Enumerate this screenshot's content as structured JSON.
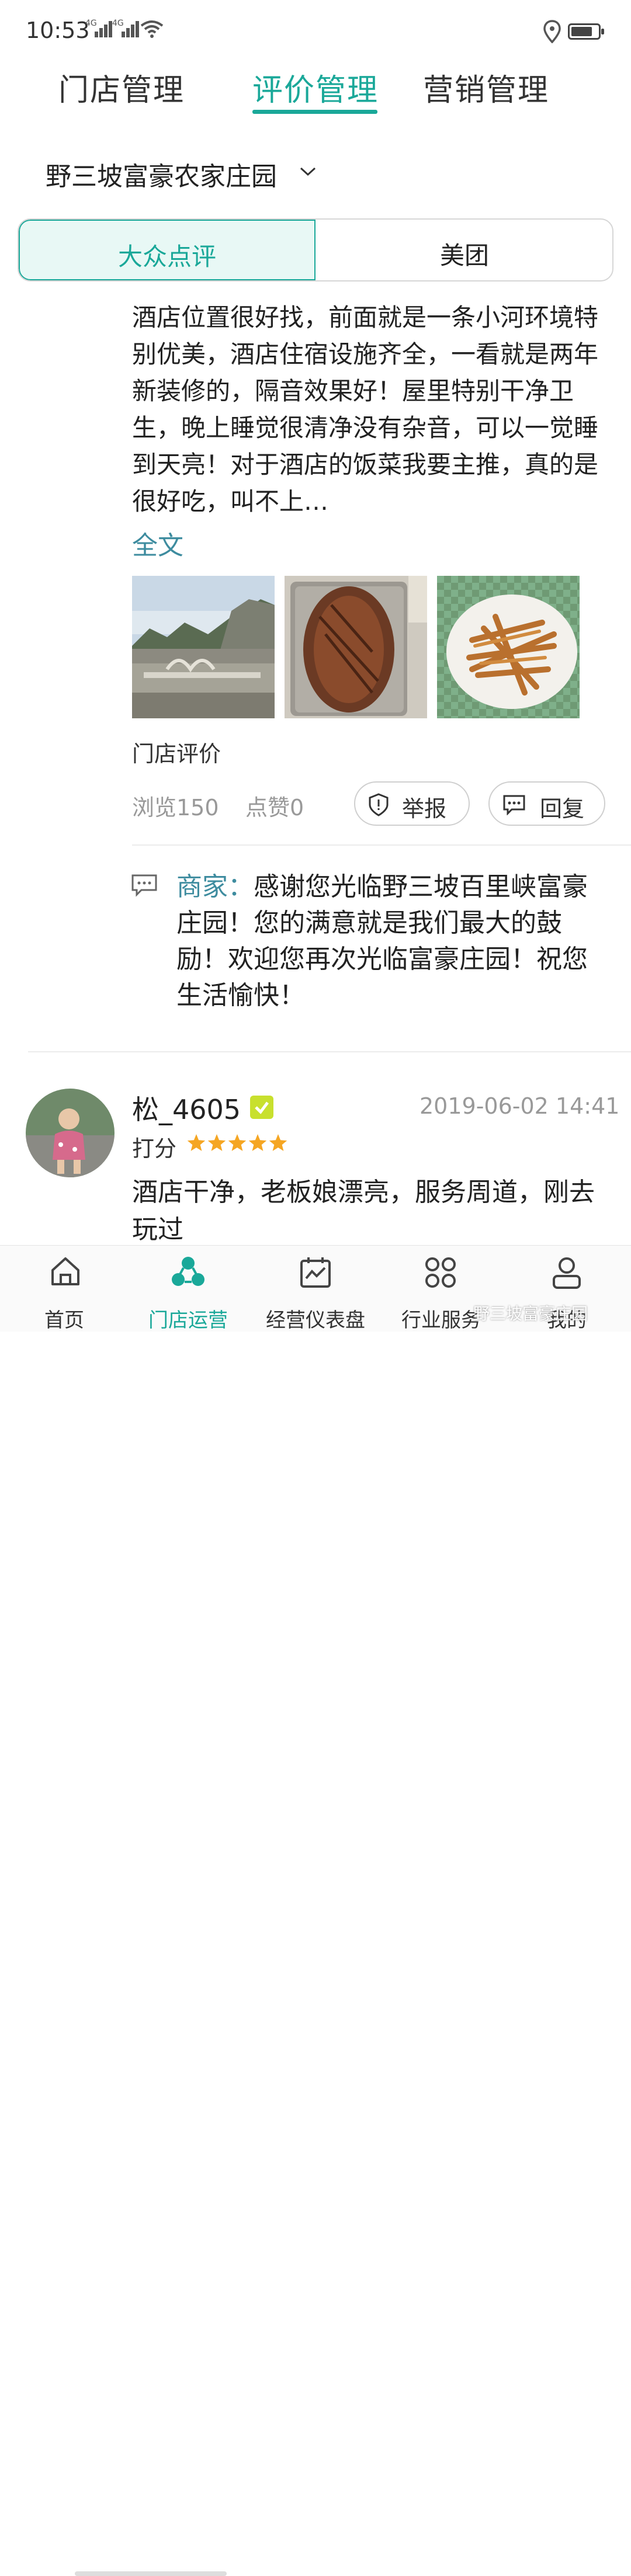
{
  "status_bar": {
    "time": "10:53",
    "signal_1_label": "4G",
    "signal_2_label": "4G",
    "battery_level": 0.8
  },
  "top_tabs": [
    {
      "label": "门店管理",
      "active": false
    },
    {
      "label": "评价管理",
      "active": true
    },
    {
      "label": "营销管理",
      "active": false
    }
  ],
  "store_selector": {
    "name": "野三坡富豪农家庄园"
  },
  "platform_tabs": [
    {
      "label": "大众点评",
      "active": true
    },
    {
      "label": "美团",
      "active": false
    }
  ],
  "review": {
    "text": "酒店位置很好找，前面就是一条小河环境特别优美，酒店住宿设施齐全，一看就是两年新装修的，隔音效果好！屋里特别干净卫生，晚上睡觉很清净没有杂音，可以一觉睡到天亮！对于酒店的饭菜我要主推，真的是很好吃，叫不上…",
    "full_text_link": "全文",
    "photos": [
      "landscape-bridge-photo",
      "grilled-fish-photo",
      "fried-small-fish-photo"
    ],
    "store_review_label": "门店评价",
    "views": "浏览150",
    "likes": "点赞0",
    "report_label": "举报",
    "reply_label": "回复"
  },
  "merchant_reply": {
    "author": "商家：",
    "text": "感谢您光临野三坡百里峡富豪庄园！您的满意就是我们最大的鼓励！欢迎您再次光临富豪庄园！祝您生活愉快！"
  },
  "next_review": {
    "username": "松_4605",
    "date": "2019-06-02 14:41",
    "score_label": "打分",
    "rating": 5,
    "text": "酒店干净，老板娘漂亮，服务周道，刚去玩过"
  },
  "bottom_nav": [
    {
      "label": "首页",
      "icon": "home-icon",
      "active": false
    },
    {
      "label": "门店运营",
      "icon": "store-ops-icon",
      "active": true
    },
    {
      "label": "经营仪表盘",
      "icon": "dashboard-icon",
      "active": false
    },
    {
      "label": "行业服务",
      "icon": "industry-service-icon",
      "active": false
    },
    {
      "label": "我的",
      "icon": "profile-icon",
      "active": false
    }
  ],
  "watermark": "野三坡富豪庄园",
  "colors": {
    "accent": "#1aa899",
    "link": "#3e8c9f",
    "star": "#f5a623",
    "muted": "#999999"
  }
}
